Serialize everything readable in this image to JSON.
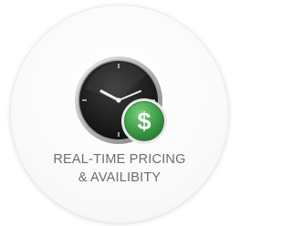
{
  "feature": {
    "title_line_1": "REAL-TIME PRICING",
    "title_line_2": "& AVAILIBITY",
    "icons": [
      "clock-icon",
      "dollar-coin-icon"
    ],
    "coin_symbol": "$",
    "colors": {
      "caption": "#6d6d6d",
      "clock_face": "#1c1c1c",
      "coin_green": "#3f9e4a",
      "coin_symbol": "#ffffff"
    }
  }
}
